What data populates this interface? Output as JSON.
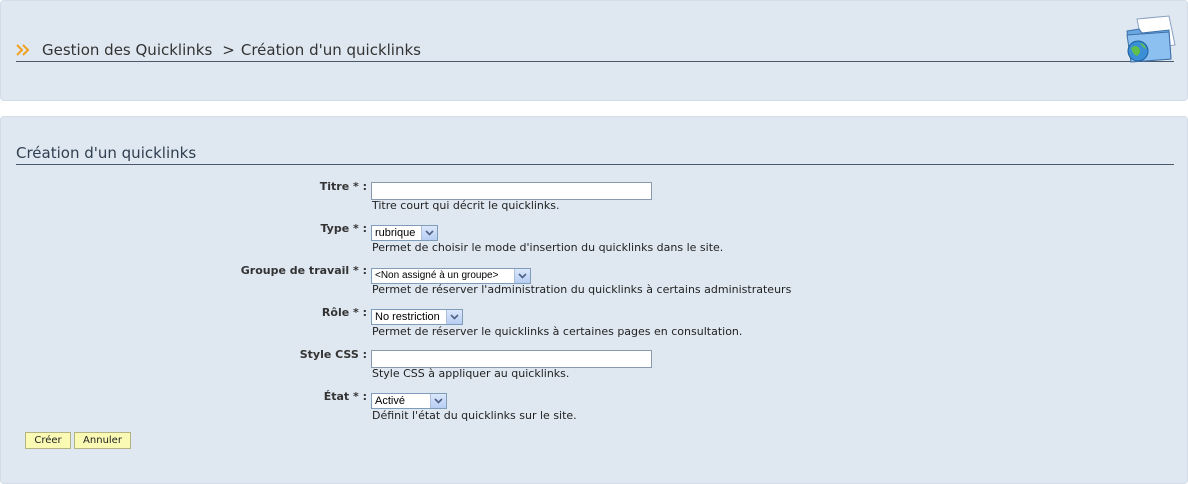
{
  "header": {
    "breadcrumb_root": "Gestion des Quicklinks",
    "breadcrumb_sep": ">",
    "breadcrumb_current": "Création d'un quicklinks",
    "icon": "folder-globe-icon"
  },
  "form": {
    "title": "Création d'un quicklinks",
    "fields": {
      "titre": {
        "label": "Titre * :",
        "value": "",
        "help": "Titre court qui décrit le quicklinks."
      },
      "type": {
        "label": "Type * :",
        "value": "rubrique",
        "help": "Permet de choisir le mode d'insertion du quicklinks dans le site."
      },
      "groupe": {
        "label": "Groupe de travail * :",
        "value": "<Non assigné à un groupe>",
        "help": "Permet de réserver l'administration du quicklinks à certains administrateurs"
      },
      "role": {
        "label": "Rôle * :",
        "value": "No restriction",
        "help": "Permet de réserver le quicklinks à certaines pages en consultation."
      },
      "css": {
        "label": "Style CSS :",
        "value": "",
        "help": "Style CSS à appliquer au quicklinks."
      },
      "etat": {
        "label": "État * :",
        "value": "Activé",
        "help": "Définit l'état du quicklinks sur le site."
      }
    },
    "buttons": {
      "create": "Créer",
      "cancel": "Annuler"
    }
  },
  "colors": {
    "panel_bg": "#dfe8f1",
    "button_bg": "#fafab5",
    "accent_arrow": "#f0a020"
  }
}
